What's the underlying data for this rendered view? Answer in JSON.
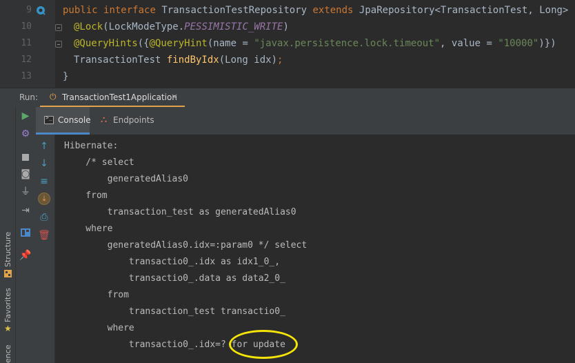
{
  "editor": {
    "line_numbers": [
      "9",
      "10",
      "11",
      "12",
      "13"
    ],
    "line9": {
      "kw1": "public",
      "kw2": "interface",
      "name": "TransactionTestRepository",
      "kw3": "extends",
      "rest": "JpaRepository<TransactionTest, Long> {"
    },
    "line10": {
      "annotation": "@Lock",
      "open": "(LockModeType.",
      "constant": "PESSIMISTIC_WRITE",
      "close": ")"
    },
    "line11": {
      "annotation": "@QueryHints",
      "p1": "({",
      "inner_annotation": "@QueryHint",
      "p2": "(name = ",
      "str1": "\"javax.persistence.lock.timeout\"",
      "p3": ", value = ",
      "str2": "\"10000\"",
      "p4": ")})"
    },
    "line12": {
      "type": "TransactionTest ",
      "method": "findByIdx",
      "args": "(Long idx)",
      "semi": ";"
    },
    "line13": {
      "text": "}"
    }
  },
  "run_panel": {
    "label": "Run:",
    "tab_label": "TransactionTest1Application",
    "tab_close": "×",
    "tab_icon": "power-icon"
  },
  "console_tabs": [
    {
      "label": "Console",
      "icon": "console-icon",
      "active": true
    },
    {
      "label": "Endpoints",
      "icon": "endpoints-icon",
      "active": false
    }
  ],
  "side_tabs": {
    "structure": "Structure",
    "favorites": "Favorites",
    "persistence": "ence"
  },
  "console_lines": [
    "Hibernate: ",
    "    /* select",
    "        generatedAlias0",
    "    from",
    "        transaction_test as generatedAlias0",
    "    where",
    "        generatedAlias0.idx=:param0 */ select",
    "            transactio0_.idx as idx1_0_,",
    "            transactio0_.data as data2_0_",
    "        from",
    "            transaction_test transactio0_",
    "        where",
    "            transactio0_.idx=? for update"
  ],
  "colors": {
    "accent_tab": "#e2a34a",
    "console_underline": "#4a88c7",
    "highlight_circle": "#f4e40a",
    "run_green": "#59a869"
  }
}
